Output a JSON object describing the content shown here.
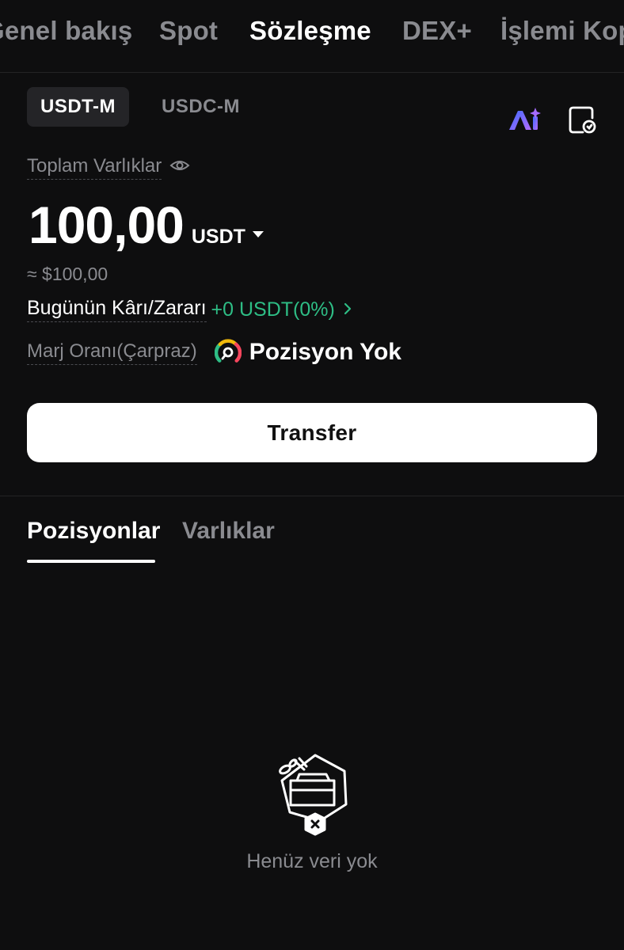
{
  "top_nav": {
    "tabs": [
      "Genel bakış",
      "Spot",
      "Sözleşme",
      "DEX+",
      "İşlemi Kopyala"
    ],
    "active": "Sözleşme"
  },
  "margin_tabs": [
    "USDT-M",
    "USDC-M"
  ],
  "header_icons": [
    "ai-icon",
    "contract-settings-icon"
  ],
  "account": {
    "total_label": "Toplam Varlıklar",
    "balance": "100,00",
    "unit": "USDT",
    "usd_approx": "≈ $100,00",
    "pnl_label": "Bugünün Kârı/Zararı",
    "pnl_value": "+0 USDT(0%)",
    "margin_label": "Marj Oranı(Çarpraz)",
    "margin_status": "Pozisyon Yok"
  },
  "transfer_label": "Transfer",
  "sub_tabs": [
    "Pozisyonlar",
    "Varlıklar"
  ],
  "empty_text": "Henüz veri yok",
  "colors": {
    "background": "#0e0e0f",
    "muted": "#8a8b90",
    "positive": "#2ebd85",
    "active_tab_bg": "#242427"
  }
}
